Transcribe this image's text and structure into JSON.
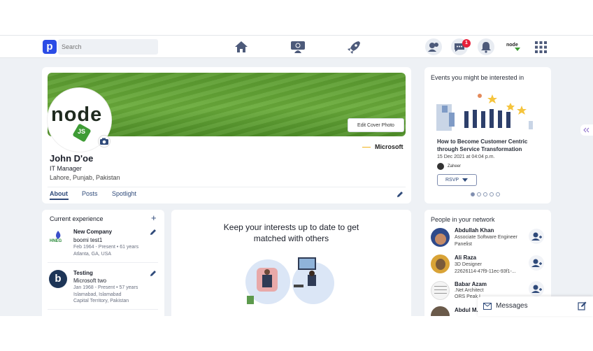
{
  "header": {
    "logo_letter": "p",
    "search_placeholder": "Search",
    "notification_count": "1",
    "brand_mini": "node"
  },
  "profile": {
    "edit_cover_label": "Edit Cover Photo",
    "name": "John D'oe",
    "title": "IT Manager",
    "location": "Lahore, Punjab, Pakistan",
    "company": "Microsoft",
    "avatar_text": "node",
    "avatar_sub": "JS",
    "tabs": [
      "About",
      "Posts",
      "Spotlight"
    ]
  },
  "experience": {
    "heading": "Current experience",
    "items": [
      {
        "company": "New Company",
        "role": "boomi test1",
        "dates": "Feb 1964 - Present  •  61 years",
        "location": "Atlanta, GA, USA",
        "logo_text": "HNEG"
      },
      {
        "company": "Testing",
        "role": "Microsoft two",
        "dates": "Jan 1968 - Present  •  57 years",
        "location1": "Islamabad, Islamabad",
        "location2": "Capital Territory, Pakistan",
        "logo_text": "b"
      }
    ]
  },
  "interests": {
    "line1": "Keep your interests up to date to get",
    "line2": "matched with others"
  },
  "events": {
    "heading": "Events you might be interested in",
    "title1": "How to Become Customer Centric",
    "title2": "through Service Transformation",
    "date": "15 Dec 2021 at 04:04 p.m.",
    "host": "Zaheer",
    "rsvp": "RSVP"
  },
  "network": {
    "heading": "People in your network",
    "people": [
      {
        "name": "Abdullah Khan",
        "line1": "Associate Software Engineer",
        "line2": "Panelist"
      },
      {
        "name": "Ali Raza",
        "line1": "3D Designer",
        "line2": "22626114-47f9-11ec-93f1-..."
      },
      {
        "name": "Babar Azam",
        "line1": ".Net Architect",
        "line2": "ORS Peak I..."
      },
      {
        "name": "Abdul M...",
        "line1": "",
        "line2": ""
      }
    ]
  },
  "messages": {
    "label": "Messages"
  },
  "colors": {
    "accent": "#2b4ce6",
    "nav_icon": "#4d5a7a",
    "link": "#2f4a7a",
    "badge": "#e8213b"
  }
}
